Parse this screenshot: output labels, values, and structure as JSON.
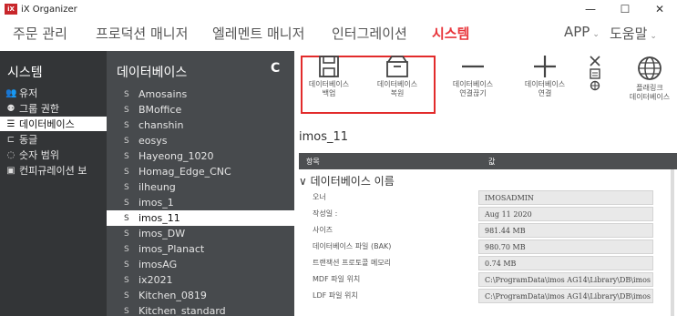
{
  "window": {
    "title": "iX Organizer",
    "logo_text": "iX",
    "min": "—",
    "max": "☐",
    "close": "✕"
  },
  "menu": [
    {
      "label": "주문 관리"
    },
    {
      "label": "프로덕션 매니저"
    },
    {
      "label": "엘레멘트 매니저"
    },
    {
      "label": "인터그레이션"
    },
    {
      "label": "시스템"
    },
    {
      "label": "APP",
      "chevron": "⌄"
    },
    {
      "label": "도움말",
      "chevron": "⌄"
    }
  ],
  "system_nav": {
    "title": "시스템",
    "items": [
      {
        "label": "유저",
        "icon": "users-icon",
        "glyph": "👥"
      },
      {
        "label": "그룹 권한",
        "icon": "group-permission-icon",
        "glyph": "⚉"
      },
      {
        "label": "데이터베이스",
        "icon": "database-icon",
        "glyph": "☰"
      },
      {
        "label": "동글",
        "icon": "dongle-icon",
        "glyph": "⊏"
      },
      {
        "label": "숫자 범위",
        "icon": "number-range-icon",
        "glyph": "◌"
      },
      {
        "label": "컨피규레이션 보",
        "icon": "configuration-icon",
        "glyph": "▣"
      }
    ]
  },
  "database_list": {
    "title": "데이터베이스",
    "refresh_glyph": "C",
    "item_glyph": "S",
    "items": [
      "Amosains",
      "BMoffice",
      "chanshin",
      "eosys",
      "Hayeong_1020",
      "Homag_Edge_CNC",
      "ilheung",
      "imos_1",
      "imos_11",
      "imos_DW",
      "imos_Planact",
      "imosAG",
      "ix2021",
      "Kitchen_0819",
      "Kitchen_standard"
    ],
    "selected": "imos_11"
  },
  "toolbar": {
    "backup": "데이터베이스\n백업",
    "restore": "데이터베이스\n복원",
    "disconnect": "데이터베이스\n연결끊기",
    "connect": "데이터베이스\n연결",
    "plugin": "플래링크\n데이터베이스"
  },
  "details": {
    "db_name": "imos_11",
    "col_item": "항목",
    "col_value": "값",
    "section_chevron": "∨",
    "section_title": "데이터베이스 이름",
    "rows": [
      {
        "label": "오너",
        "value": "IMOSADMIN"
      },
      {
        "label": "작성일 :",
        "value": "Aug 11 2020"
      },
      {
        "label": "사이즈",
        "value": "981.44 MB"
      },
      {
        "label": "데이터베이스 파일 (BAK)",
        "value": "980.70 MB"
      },
      {
        "label": "트랜잭션 프로토콜 메모리",
        "value": "0.74 MB"
      },
      {
        "label": "MDF 파일 위치",
        "value": "C:\\ProgramData\\imos AG14\\Library\\DB\\imos"
      },
      {
        "label": "LDF 파일 위치",
        "value": "C:\\ProgramData\\imos AG14\\Library\\DB\\imos"
      }
    ]
  },
  "colors": {
    "accent": "#e8353b",
    "sidebar_dark": "#333537",
    "sidebar_mid": "#474a4d",
    "highlight_border": "#e22b2b"
  }
}
